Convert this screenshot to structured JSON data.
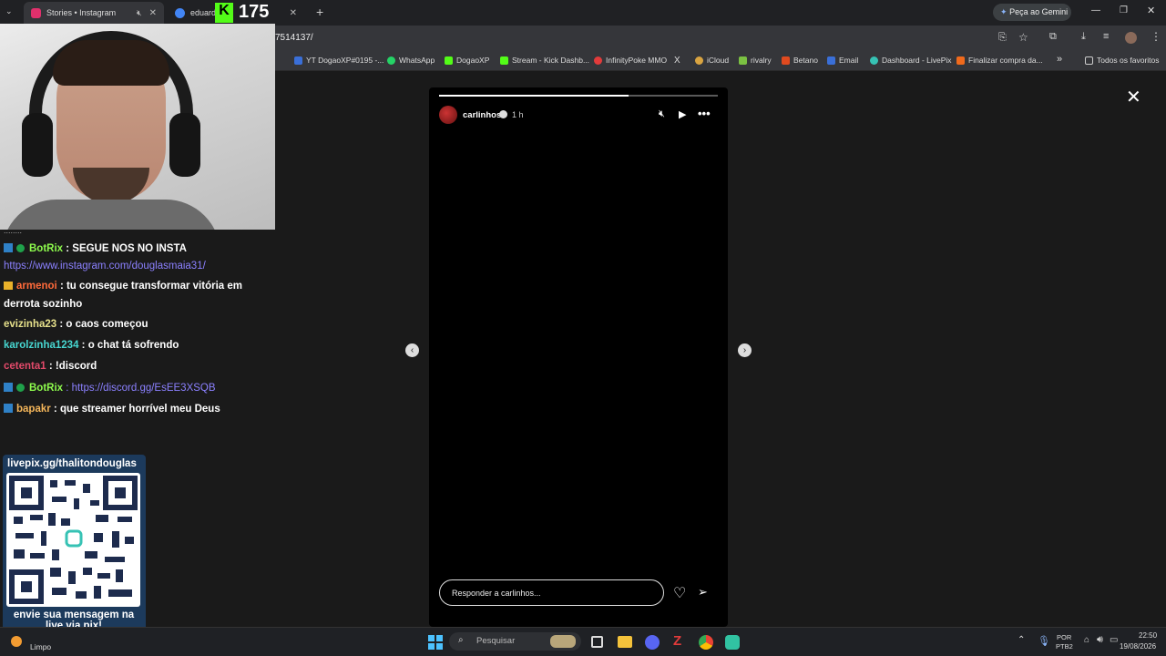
{
  "browser": {
    "tabs": [
      {
        "label": "Stories • Instagram",
        "fav_color": "#e1306c",
        "active": true
      },
      {
        "label": "eduarda",
        "fav_color": "#4285f4",
        "active": false
      }
    ],
    "kick_overlay_count": "175",
    "url": "7514137/",
    "gemini_label": "Peça ao Gemini",
    "bookmarks": [
      {
        "label": "YT DogaoXP#0195 -...",
        "color": "#3a6fd8"
      },
      {
        "label": "WhatsApp",
        "color": "#25d366"
      },
      {
        "label": "DogaoXP",
        "color": "#53fc18"
      },
      {
        "label": "Stream - Kick Dashb...",
        "color": "#53fc18"
      },
      {
        "label": "InfinityPoke MMO",
        "color": "#e23b3b"
      },
      {
        "label": "X",
        "color": "#ffffff"
      },
      {
        "label": "iCloud",
        "color": "#d9a441"
      },
      {
        "label": "rivalry",
        "color": "#7bc142"
      },
      {
        "label": "Betano",
        "color": "#e04a1f"
      },
      {
        "label": "Email",
        "color": "#3a6fd8"
      },
      {
        "label": "Dashboard - LivePix",
        "color": "#36c2b4"
      },
      {
        "label": "Finalizar compra da...",
        "color": "#f06a1c"
      }
    ],
    "all_favorites": "Todos os favoritos"
  },
  "story": {
    "username": "carlinhos",
    "time": "1 h",
    "progress": 0.68,
    "reply_placeholder": "Responder a carlinhos..."
  },
  "chat": {
    "dots": "........",
    "messages": [
      {
        "user": "BotRix",
        "user_color": "#8dfa4d",
        "text": ": SEGUE NOS NO INSTA",
        "badges": [
          "bot",
          "verified"
        ]
      },
      {
        "user": "",
        "user_color": "#ffffff",
        "text": "https://www.instagram.com/douglasmaia31/",
        "badges": [],
        "link": true
      },
      {
        "user": "armenoi",
        "user_color": "#ff6a3a",
        "text": ": tu consegue transformar vitória em",
        "badges": [
          "sub"
        ]
      },
      {
        "user": "",
        "user_color": "#ffffff",
        "text": "derrota sozinho",
        "badges": []
      },
      {
        "user": "evizinha23",
        "user_color": "#e6e08b",
        "text": ": o caos começou",
        "badges": []
      },
      {
        "user": "karolzinha1234",
        "user_color": "#47d6d0",
        "text": ": o chat tá sofrendo",
        "badges": []
      },
      {
        "user": "cetenta1",
        "user_color": "#e34a6a",
        "text": ": !discord",
        "badges": []
      },
      {
        "user": "BotRix",
        "user_color": "#8dfa4d",
        "text": ": https://discord.gg/EsEE3XSQB",
        "badges": [
          "bot",
          "verified"
        ],
        "link": true
      },
      {
        "user": "bapakr",
        "user_color": "#f5b65a",
        "text": ": que streamer horrível meu Deus",
        "badges": [
          "bot"
        ]
      }
    ]
  },
  "livepix": {
    "title": "livepix.gg/thalitondouglas",
    "bottom": "envie sua mensagem na live via pix!"
  },
  "taskbar": {
    "weather": "Limpo",
    "search_placeholder": "Pesquisar",
    "lang_top": "POR",
    "lang_bottom": "PTB2",
    "time": "22:50",
    "date": "19/08/2026"
  }
}
